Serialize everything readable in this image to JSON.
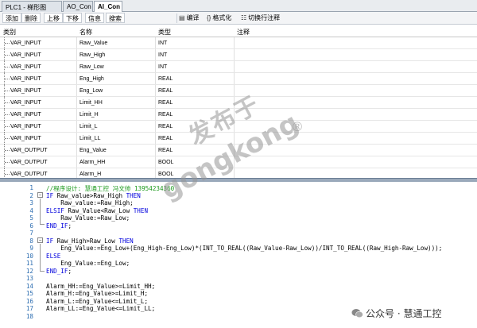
{
  "tabs": [
    {
      "label": "PLC1 - 梯形图",
      "active": false
    },
    {
      "label": "AO_Con",
      "active": false
    },
    {
      "label": "AI_Con",
      "active": true
    }
  ],
  "toolbar": {
    "add": "添加",
    "delete": "删除",
    "move_up": "上移",
    "move_down": "下移",
    "info": "信息",
    "search": "搜索",
    "compile": "编译",
    "format": "格式化",
    "toggle_comment": "切换行注释"
  },
  "table": {
    "headers": [
      "类别",
      "名称",
      "类型",
      "注释"
    ],
    "rows": [
      {
        "category": "VAR_INPUT",
        "name": "Raw_Value",
        "type": "INT",
        "comment": ""
      },
      {
        "category": "VAR_INPUT",
        "name": "Raw_High",
        "type": "INT",
        "comment": ""
      },
      {
        "category": "VAR_INPUT",
        "name": "Raw_Low",
        "type": "INT",
        "comment": ""
      },
      {
        "category": "VAR_INPUT",
        "name": "Eng_High",
        "type": "REAL",
        "comment": ""
      },
      {
        "category": "VAR_INPUT",
        "name": "Eng_Low",
        "type": "REAL",
        "comment": ""
      },
      {
        "category": "VAR_INPUT",
        "name": "Limit_HH",
        "type": "REAL",
        "comment": ""
      },
      {
        "category": "VAR_INPUT",
        "name": "Limit_H",
        "type": "REAL",
        "comment": ""
      },
      {
        "category": "VAR_INPUT",
        "name": "Limit_L",
        "type": "REAL",
        "comment": ""
      },
      {
        "category": "VAR_INPUT",
        "name": "Limit_LL",
        "type": "REAL",
        "comment": ""
      },
      {
        "category": "VAR_OUTPUT",
        "name": "Eng_Value",
        "type": "REAL",
        "comment": ""
      },
      {
        "category": "VAR_OUTPUT",
        "name": "Alarm_HH",
        "type": "BOOL",
        "comment": ""
      },
      {
        "category": "VAR_OUTPUT",
        "name": "Alarm_H",
        "type": "BOOL",
        "comment": ""
      }
    ]
  },
  "code": {
    "lines": [
      {
        "n": "1",
        "text": "//程序设计: 慧通工控 冯文帅 13954234360"
      },
      {
        "n": "2",
        "text": "IF Raw_value>Raw_High THEN"
      },
      {
        "n": "3",
        "text": "    Raw_value:=Raw_High;"
      },
      {
        "n": "4",
        "text": "ELSIF Raw_Value<Raw_Low THEN"
      },
      {
        "n": "5",
        "text": "    Raw_Value:=Raw_Low;"
      },
      {
        "n": "6",
        "text": "END_IF;"
      },
      {
        "n": "7",
        "text": ""
      },
      {
        "n": "8",
        "text": "IF Raw_High>Raw_Low THEN"
      },
      {
        "n": "9",
        "text": "    Eng_Value:=Eng_Low+(Eng_High-Eng_Low)*(INT_TO_REAL((Raw_Value-Raw_Low))/INT_TO_REAL((Raw_High-Raw_Low)));"
      },
      {
        "n": "10",
        "text": "ELSE"
      },
      {
        "n": "11",
        "text": "    Eng_Value:=Eng_Low;"
      },
      {
        "n": "12",
        "text": "END_IF;"
      },
      {
        "n": "13",
        "text": ""
      },
      {
        "n": "14",
        "text": "Alarm_HH:=Eng_Value>=Limit_HH;"
      },
      {
        "n": "15",
        "text": "Alarm_H:=Eng_Value>=Limit_H;"
      },
      {
        "n": "16",
        "text": "Alarm_L:=Eng_Value<=Limit_L;"
      },
      {
        "n": "17",
        "text": "Alarm_LL:=Eng_Value<=Limit_LL;"
      },
      {
        "n": "18",
        "text": ""
      }
    ]
  },
  "watermark": {
    "cn": "发布于",
    "en": "gongkong",
    "reg": "®"
  },
  "brand": {
    "label": "公众号 · 慧通工控"
  },
  "colors": {
    "keyword": "#0000dd",
    "comment": "#1c9a1c",
    "line_number": "#2b6cb0"
  }
}
